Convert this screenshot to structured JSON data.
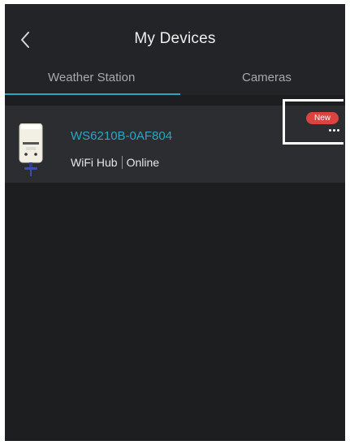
{
  "header": {
    "title": "My Devices",
    "back_icon": "chevron-left-icon"
  },
  "tabs": [
    {
      "label": "Weather Station",
      "active": true
    },
    {
      "label": "Cameras",
      "active": false
    }
  ],
  "device": {
    "name": "WS6210B-0AF804",
    "type": "WiFi Hub",
    "status": "Online",
    "badge": "New",
    "image_icon": "weather-station-device-icon",
    "more_icon": "more-horizontal-icon"
  },
  "colors": {
    "background": "#1d1e20",
    "header": "#232427",
    "card": "#2c2d30",
    "accent": "#2aa6c4",
    "badge": "#d9443f"
  }
}
